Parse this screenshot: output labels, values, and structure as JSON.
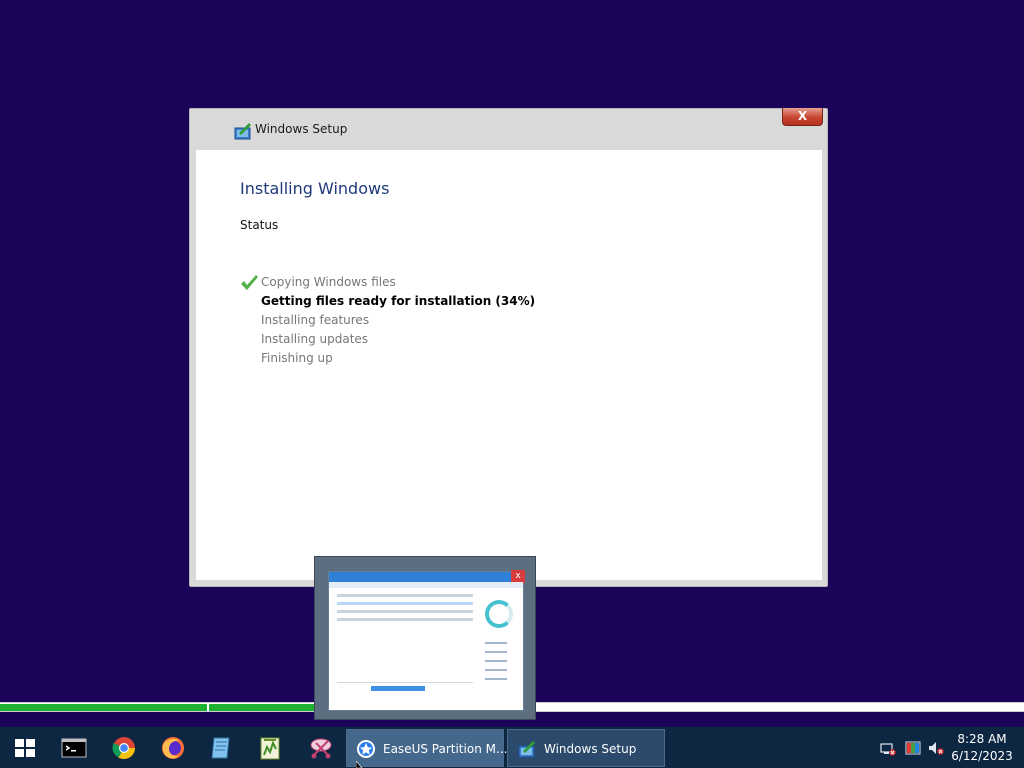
{
  "window": {
    "title": "Windows Setup",
    "close_label": "X",
    "heading": "Installing Windows",
    "status_label": "Status",
    "steps": [
      {
        "label": "Copying Windows files",
        "state": "done"
      },
      {
        "label": "Getting files ready for installation (34%)",
        "state": "active"
      },
      {
        "label": "Installing features",
        "state": "pending"
      },
      {
        "label": "Installing updates",
        "state": "pending"
      },
      {
        "label": "Finishing up",
        "state": "pending"
      }
    ]
  },
  "progress": {
    "overall_fraction": 0.31,
    "color": "#1fb133"
  },
  "thumbnail": {
    "close_label": "x"
  },
  "taskbar": {
    "pinned_icons": [
      "windows-start-icon",
      "command-prompt-icon",
      "chrome-icon",
      "firefox-icon",
      "notepad-icon",
      "notepad-plus-plus-icon",
      "snipping-tool-icon"
    ],
    "apps": [
      {
        "label": "EaseUS Partition M...",
        "icon": "easeus-icon",
        "state": "active"
      },
      {
        "label": "Windows Setup",
        "icon": "windows-setup-icon",
        "state": "inactive"
      }
    ],
    "tray_icons": [
      "network-disconnected-icon",
      "color-profile-icon",
      "volume-muted-icon"
    ],
    "clock": {
      "time": "8:28 AM",
      "date": "6/12/2023"
    }
  },
  "colors": {
    "desktop_background": "#1a0358",
    "taskbar_background": "#0d2642",
    "heading_text": "#1f3a7a"
  }
}
